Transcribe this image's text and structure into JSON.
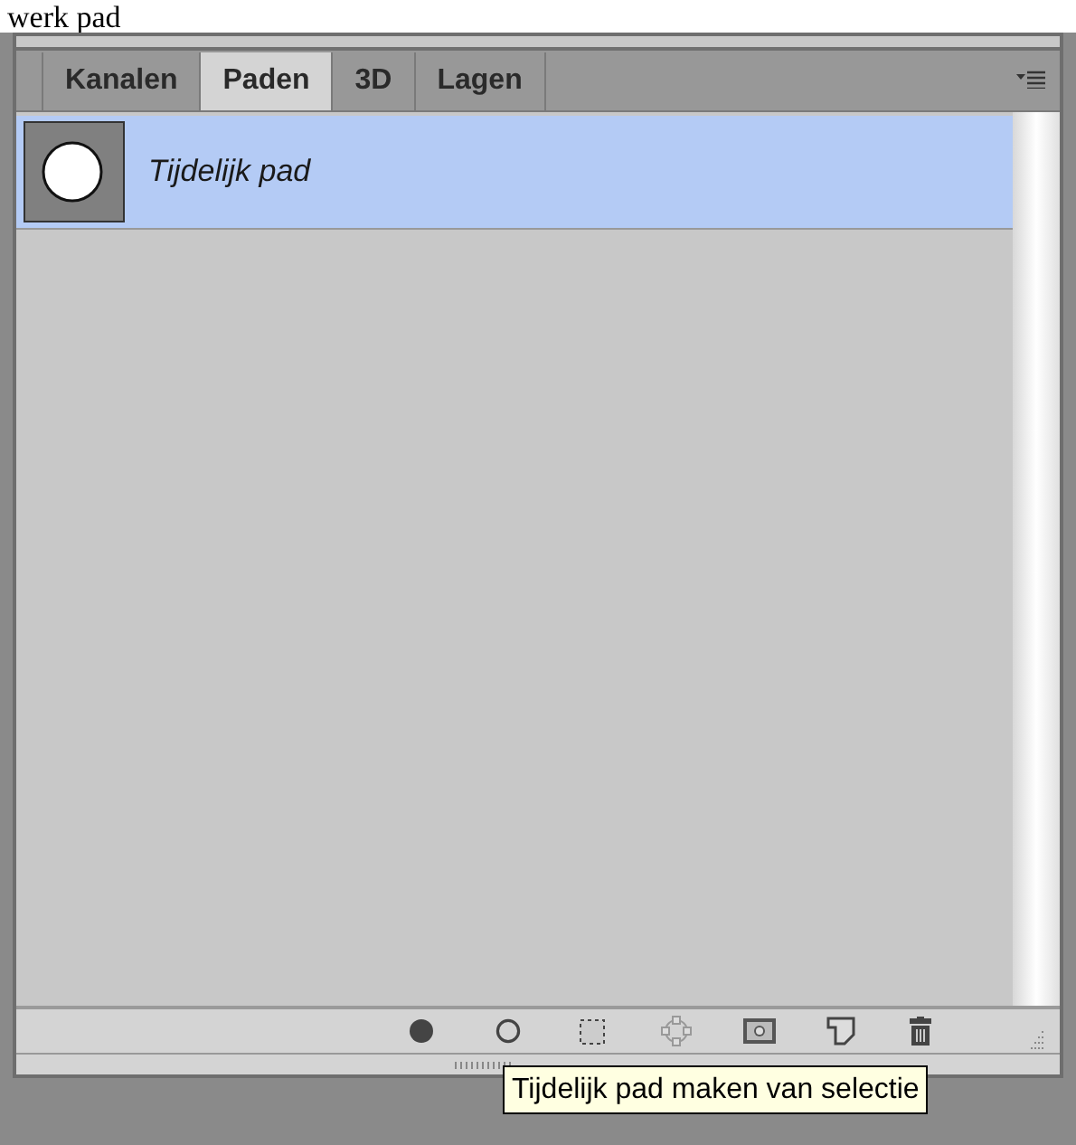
{
  "document_text": "werk pad",
  "tabs": [
    {
      "label": "Kanalen",
      "selected": false
    },
    {
      "label": "Paden",
      "selected": true
    },
    {
      "label": "3D",
      "selected": false
    },
    {
      "label": "Lagen",
      "selected": false
    }
  ],
  "paths": [
    {
      "name": "Tijdelijk pad",
      "selected": true
    }
  ],
  "tooltip": "Tijdelijk pad maken van selectie"
}
